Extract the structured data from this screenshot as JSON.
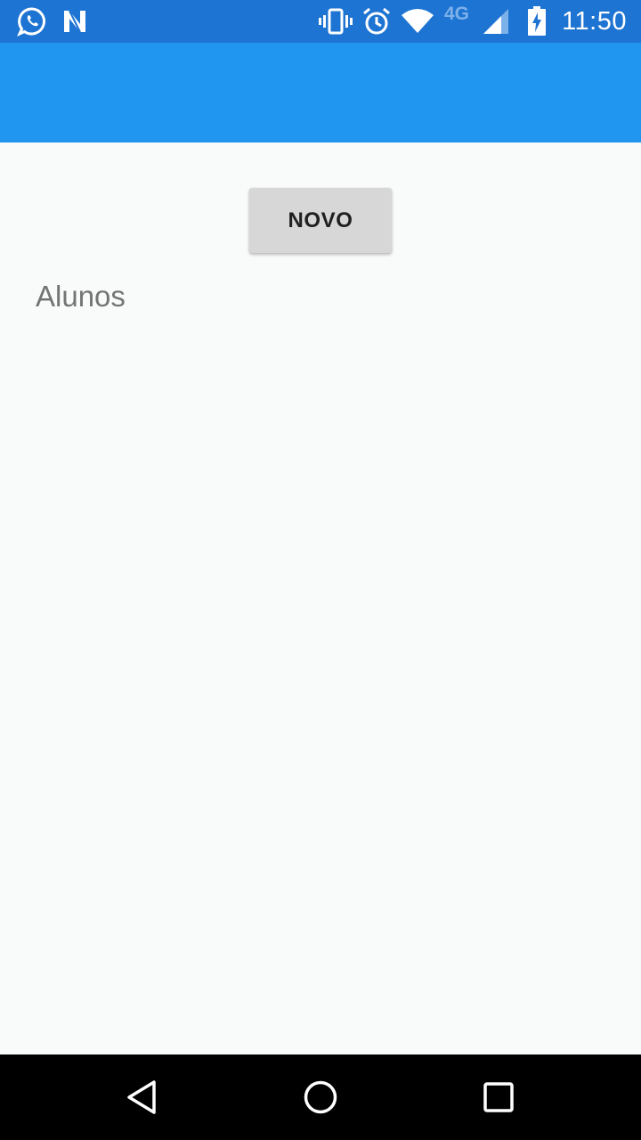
{
  "status_bar": {
    "time": "11:50",
    "network_type": "4G",
    "icons": [
      "whatsapp-icon",
      "n-notification-icon",
      "vibrate-icon",
      "alarm-icon",
      "wifi-icon",
      "signal-icon",
      "battery-charging-icon"
    ],
    "background": "#1e74d2"
  },
  "app_bar": {
    "background": "#2196f0"
  },
  "main": {
    "new_button_label": "NOVO",
    "section_label": "Alunos"
  },
  "nav_bar": {
    "icons": [
      "back-icon",
      "home-icon",
      "recents-icon"
    ]
  }
}
